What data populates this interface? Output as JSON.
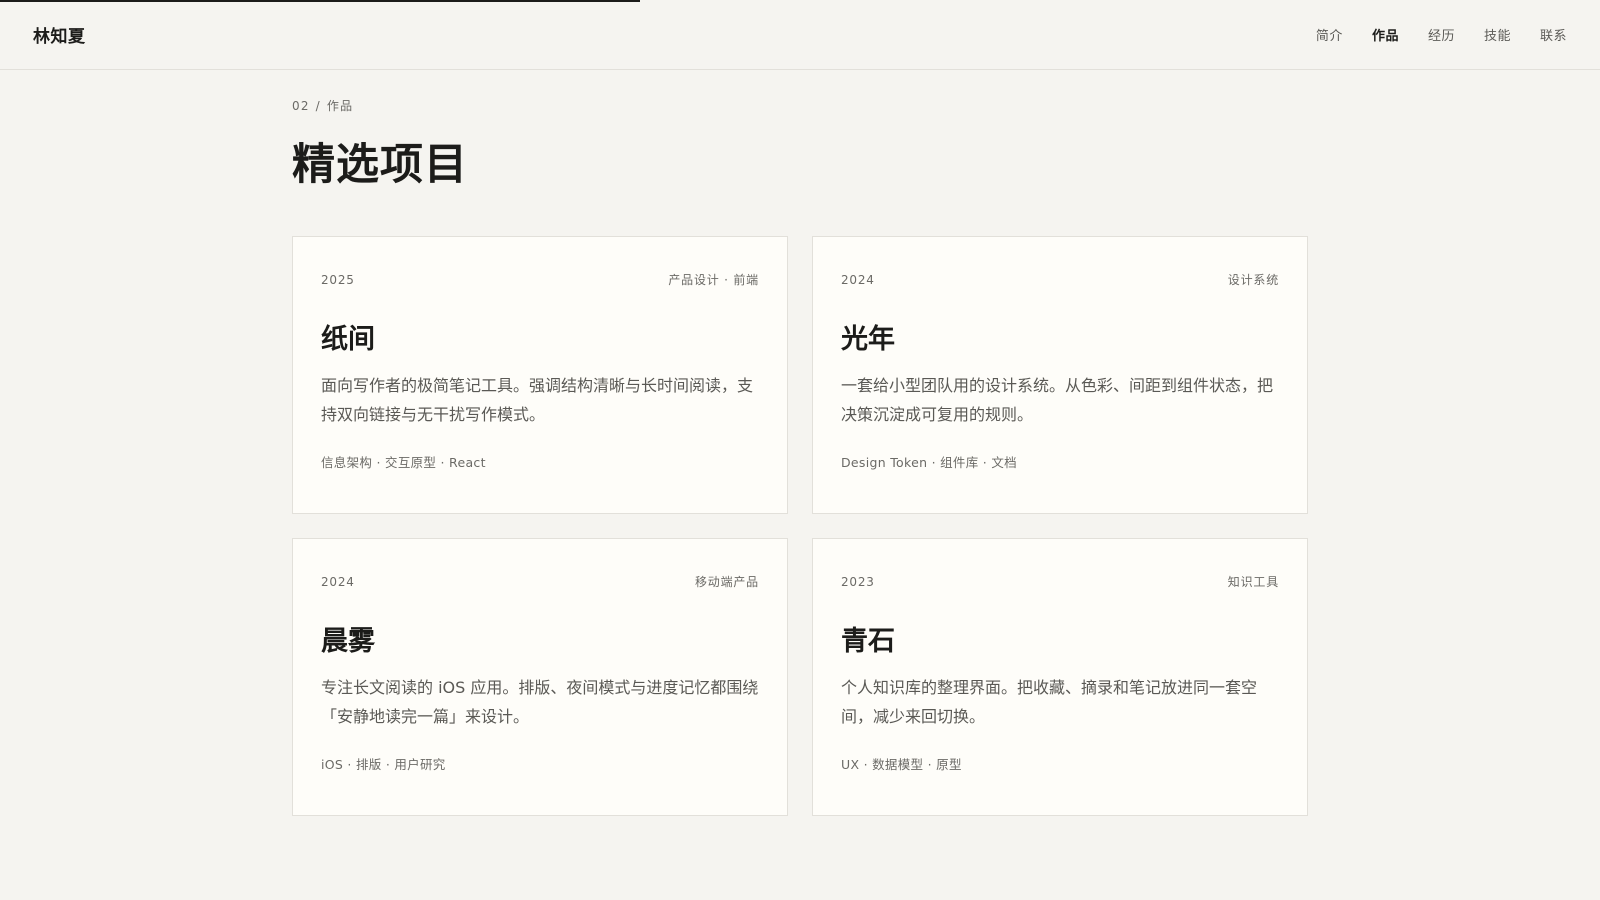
{
  "reading_progress": 0.4,
  "header": {
    "brand": "林知夏",
    "nav": [
      {
        "label": "简介",
        "active": false
      },
      {
        "label": "作品",
        "active": true
      },
      {
        "label": "经历",
        "active": false
      },
      {
        "label": "技能",
        "active": false
      },
      {
        "label": "联系",
        "active": false
      }
    ]
  },
  "main": {
    "breadcrumb": {
      "index": "02",
      "separator": "/",
      "section": "作品"
    },
    "title": "精选项目",
    "projects": [
      {
        "year": "2025",
        "category": "产品设计 · 前端",
        "title": "纸间",
        "description": "面向写作者的极简笔记工具。强调结构清晰与长时间阅读，支持双向链接与无干扰写作模式。",
        "tags": "信息架构 · 交互原型 · React"
      },
      {
        "year": "2024",
        "category": "设计系统",
        "title": "光年",
        "description": "一套给小型团队用的设计系统。从色彩、间距到组件状态，把决策沉淀成可复用的规则。",
        "tags": "Design Token · 组件库 · 文档"
      },
      {
        "year": "2024",
        "category": "移动端产品",
        "title": "晨雾",
        "description": "专注长文阅读的 iOS 应用。排版、夜间模式与进度记忆都围绕「安静地读完一篇」来设计。",
        "tags": "iOS · 排版 · 用户研究"
      },
      {
        "year": "2023",
        "category": "知识工具",
        "title": "青石",
        "description": "个人知识库的整理界面。把收藏、摘录和笔记放进同一套空间，减少来回切换。",
        "tags": "UX · 数据模型 · 原型"
      }
    ]
  }
}
